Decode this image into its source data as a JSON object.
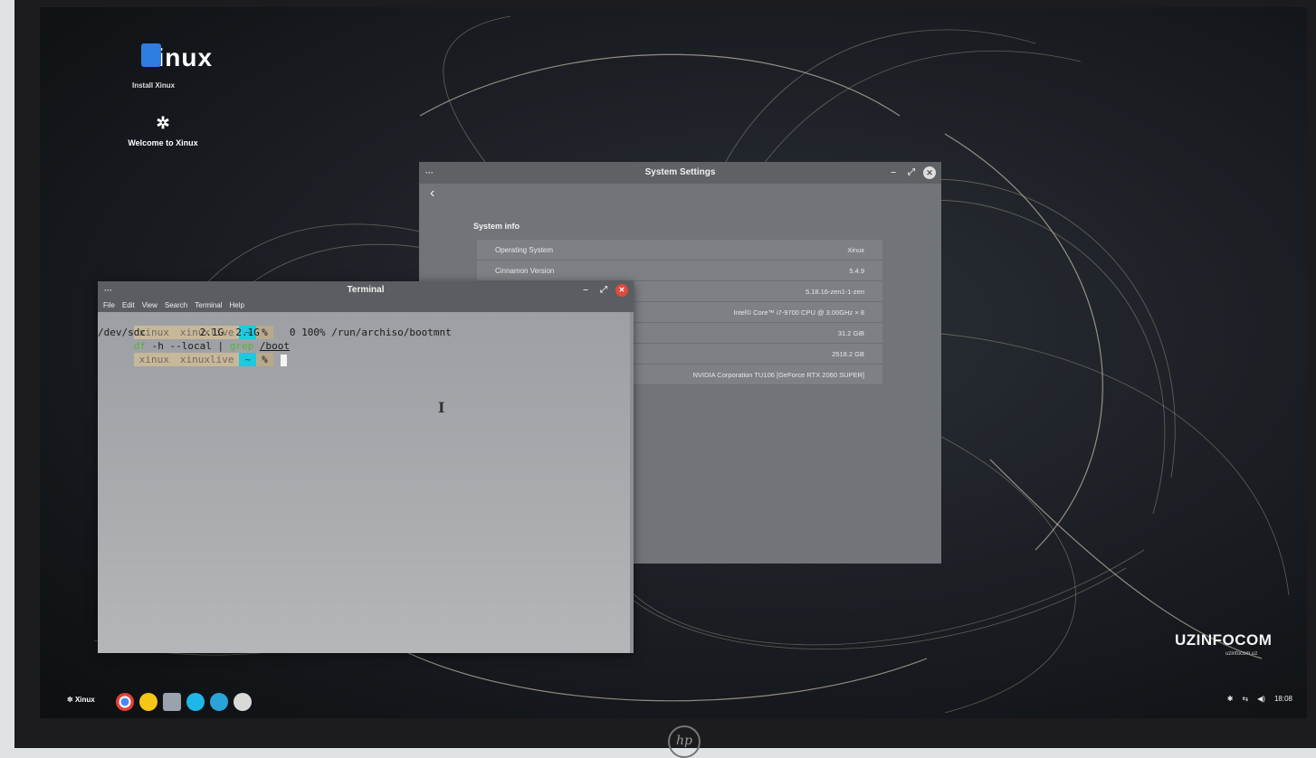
{
  "desktop": {
    "install_logo": "xinux",
    "install_label": "Install Xinux",
    "welcome_label": "Welcome to Xinux",
    "watermark": "UZINFOCOM",
    "watermark_sub": "uzinfocom.uz",
    "bezel_logo": "hp"
  },
  "settings_window": {
    "title": "System Settings",
    "menu_dots": "···",
    "minimize": "–",
    "maximize": "⤢",
    "close": "✕",
    "back": "‹",
    "section_title": "System info",
    "rows": [
      {
        "label": "Operating System",
        "value": "Xinux"
      },
      {
        "label": "Cinnamon Version",
        "value": "5.4.9"
      },
      {
        "label": "",
        "value": "5.18.16-zen1-1-zen"
      },
      {
        "label": "",
        "value": "Intel© Core™ i7-9700 CPU @ 3.00GHz × 8"
      },
      {
        "label": "",
        "value": "31.2 GiB"
      },
      {
        "label": "",
        "value": "2518.2 GB"
      },
      {
        "label": "",
        "value": "NVIDIA Corporation TU106 [GeForce RTX 2060 SUPER]"
      }
    ]
  },
  "terminal_window": {
    "title": "Terminal",
    "menu_dots": "···",
    "minimize": "–",
    "maximize": "⤢",
    "close": "✕",
    "menu": [
      "File",
      "Edit",
      "View",
      "Search",
      "Terminal",
      "Help"
    ],
    "prompt": {
      "user": "xinux",
      "host": "xinuxlive",
      "dir": "~",
      "symbol": "%"
    },
    "command": {
      "df": "df",
      "args": " -h --local | ",
      "grep": "grep",
      "path": "/boot"
    },
    "output": "/dev/sdc         2.1G  2.1G     0 100% /run/archiso/bootmnt"
  },
  "taskbar": {
    "menu_label": "Xinux",
    "time": "18:08",
    "icons": [
      "chrome-icon",
      "files-icon",
      "settings-icon",
      "terminal-icon",
      "browser-icon",
      "software-icon"
    ],
    "tray": [
      "bluetooth-icon",
      "network-icon",
      "volume-icon"
    ]
  }
}
